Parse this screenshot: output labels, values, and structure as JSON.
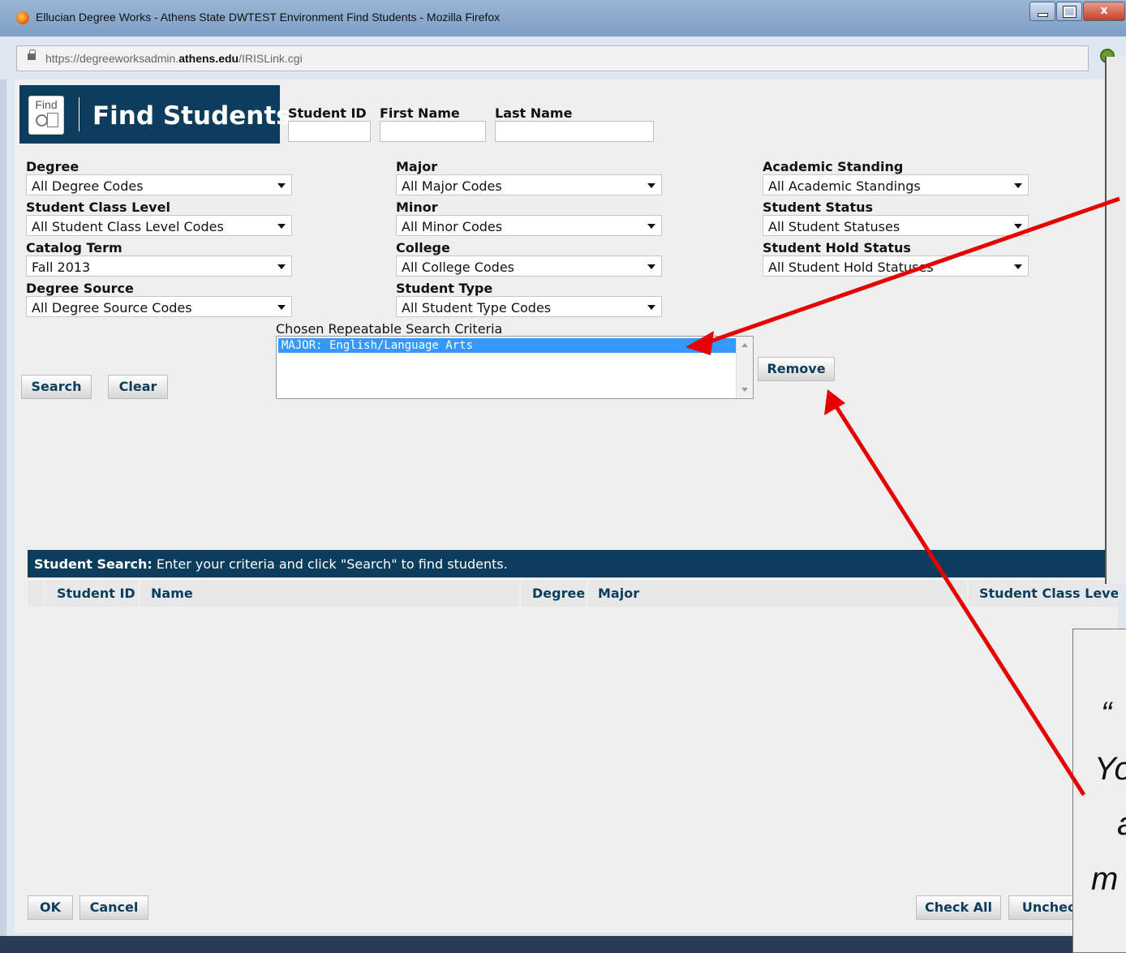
{
  "window": {
    "title": "Ellucian Degree Works - Athens State DWTEST Environment Find Students - Mozilla Firefox",
    "url_prefix": "https://degreeworksadmin.",
    "url_domain": "athens.edu",
    "url_path": "/IRISLink.cgi",
    "close_label": "x"
  },
  "header": {
    "icon_word": "Find",
    "title": "Find Students"
  },
  "search_fields": {
    "student_id_label": "Student ID",
    "first_name_label": "First Name",
    "last_name_label": "Last Name",
    "student_id_value": "",
    "first_name_value": "",
    "last_name_value": ""
  },
  "filters": {
    "degree": {
      "label": "Degree",
      "value": "All Degree Codes"
    },
    "student_class_level": {
      "label": "Student Class Level",
      "value": "All Student Class Level Codes"
    },
    "catalog_term": {
      "label": "Catalog Term",
      "value": "Fall 2013"
    },
    "degree_source": {
      "label": "Degree Source",
      "value": "All Degree Source Codes"
    },
    "major": {
      "label": "Major",
      "value": "All Major Codes"
    },
    "minor": {
      "label": "Minor",
      "value": "All Minor Codes"
    },
    "college": {
      "label": "College",
      "value": "All College Codes"
    },
    "student_type": {
      "label": "Student Type",
      "value": "All Student Type Codes"
    },
    "academic_standing": {
      "label": "Academic Standing",
      "value": "All Academic Standings"
    },
    "student_status": {
      "label": "Student Status",
      "value": "All Student Statuses"
    },
    "student_hold_status": {
      "label": "Student Hold Status",
      "value": "All Student Hold Statuses"
    }
  },
  "criteria": {
    "label": "Chosen Repeatable Search Criteria",
    "items": [
      "MAJOR: English/Language Arts"
    ]
  },
  "buttons": {
    "search": "Search",
    "clear": "Clear",
    "remove": "Remove",
    "ok": "OK",
    "cancel": "Cancel",
    "check_all": "Check All",
    "uncheck": "Uncheck"
  },
  "results": {
    "bar_title": "Student Search:",
    "bar_text": " Enter your criteria and click \"Search\" to find students.",
    "columns": [
      "Student ID",
      "Name",
      "Degree",
      "Major",
      "Student Class Level"
    ]
  },
  "annotation": {
    "lines": [
      "“",
      "Yo",
      "a",
      "m"
    ]
  },
  "colors": {
    "brand": "#0d3d5c",
    "selection": "#3399ff",
    "arrow": "#e60000"
  }
}
